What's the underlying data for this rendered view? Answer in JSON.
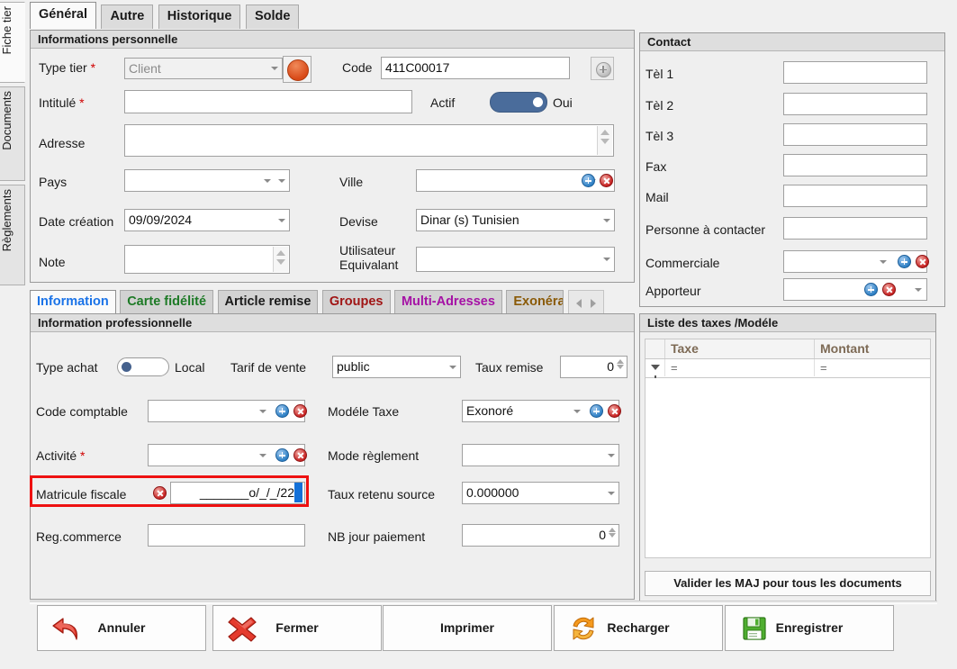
{
  "side_tabs": [
    {
      "label": "Fiche tier",
      "active": true
    },
    {
      "label": "Documents",
      "active": false
    },
    {
      "label": "Règlements",
      "active": false
    }
  ],
  "top_tabs": [
    {
      "label": "Général",
      "active": true
    },
    {
      "label": "Autre",
      "active": false
    },
    {
      "label": "Historique",
      "active": false
    },
    {
      "label": "Solde",
      "active": false
    }
  ],
  "personal": {
    "title": "Informations personnelle",
    "type_tier_label": "Type tier",
    "type_tier_value": "Client",
    "code_label": "Code",
    "code_value": "411C00017",
    "intitule_label": "Intitulé",
    "intitule_value": "",
    "actif_label": "Actif",
    "actif_state": "Oui",
    "adresse_label": "Adresse",
    "adresse_value": "",
    "pays_label": "Pays",
    "pays_value": "",
    "ville_label": "Ville",
    "ville_value": "",
    "date_creation_label": "Date création",
    "date_creation_value": "09/09/2024",
    "devise_label": "Devise",
    "devise_value": "Dinar (s) Tunisien",
    "note_label": "Note",
    "note_value": "",
    "utilisateur_label_line1": "Utilisateur",
    "utilisateur_label_line2": "Equivalant",
    "utilisateur_value": "",
    "required_marker": "*"
  },
  "contact": {
    "title": "Contact",
    "rows": [
      {
        "label": "Tèl 1",
        "value": ""
      },
      {
        "label": "Tèl 2",
        "value": ""
      },
      {
        "label": "Tèl 3",
        "value": ""
      },
      {
        "label": "Fax",
        "value": ""
      },
      {
        "label": "Mail",
        "value": ""
      },
      {
        "label": "Personne à contacter",
        "value": ""
      },
      {
        "label": "Commerciale",
        "value": ""
      },
      {
        "label": "Apporteur",
        "value": ""
      }
    ]
  },
  "sub_tabs": [
    {
      "label": "Information",
      "active": true,
      "color": "#1a73e8"
    },
    {
      "label": "Carte fidélité",
      "active": false,
      "color": "#1d7a26"
    },
    {
      "label": "Article remise",
      "active": false,
      "color": "#1a1a1a"
    },
    {
      "label": "Groupes",
      "active": false,
      "color": "#a01515"
    },
    {
      "label": "Multi-Adresses",
      "active": false,
      "color": "#a512a5"
    },
    {
      "label": "Exonéra",
      "active": false,
      "color": "#8a5a07"
    }
  ],
  "professional": {
    "title": "Information professionnelle",
    "type_achat_label": "Type achat",
    "type_achat_state": "Local",
    "tarif_vente_label": "Tarif de vente",
    "tarif_vente_value": "public",
    "taux_remise_label": "Taux remise",
    "taux_remise_value": "0",
    "code_comptable_label": "Code comptable",
    "code_comptable_value": "",
    "modele_taxe_label": "Modéle Taxe",
    "modele_taxe_value": "Exonoré",
    "activite_label": "Activité",
    "activite_value": "",
    "mode_reglement_label": "Mode règlement",
    "mode_reglement_value": "",
    "matricule_label": "Matricule fiscale",
    "matricule_value": "_______o/_/_/22",
    "taux_retenu_label": "Taux retenu source",
    "taux_retenu_value": "0.000000",
    "reg_commerce_label": "Reg.commerce",
    "reg_commerce_value": "",
    "nb_jour_label": "NB jour paiement",
    "nb_jour_value": "0",
    "required_marker": "*"
  },
  "taxes": {
    "title": "Liste des taxes /Modéle",
    "columns": [
      "Taxe",
      "Montant"
    ],
    "filter_row": [
      "=",
      "="
    ],
    "rows": [],
    "valider_button": "Valider les MAJ pour tous les documents"
  },
  "buttons": [
    {
      "label": "Annuler",
      "icon": "undo-arrow-icon"
    },
    {
      "label": "Fermer",
      "icon": "red-cross-icon"
    },
    {
      "label": "Imprimer",
      "icon": "none"
    },
    {
      "label": "Recharger",
      "icon": "refresh-icon"
    },
    {
      "label": "Enregistrer",
      "icon": "floppy-disk-icon"
    }
  ],
  "colors": {
    "highlight_border": "#ee1111",
    "toggle_on": "#4a6c9b",
    "selection": "#1471d8"
  }
}
